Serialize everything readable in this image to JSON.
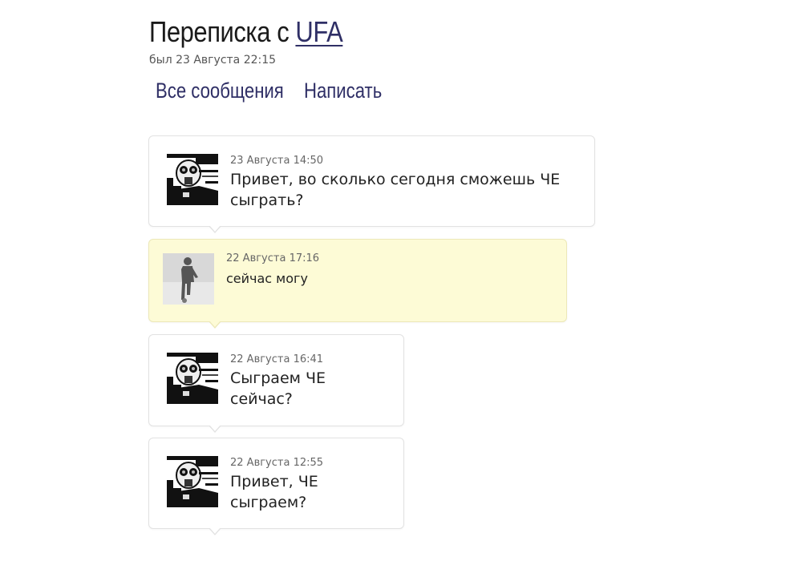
{
  "header": {
    "title_prefix": "Переписка с",
    "contact_name": "UFA",
    "last_seen": "был 23 Августа 22:15"
  },
  "tabs": [
    {
      "label": "Все сообщения"
    },
    {
      "label": "Написать"
    }
  ],
  "messages": [
    {
      "author": "UFA",
      "avatar_icon": "gas-mask-avatar-icon",
      "date": "23 Августа 14:50",
      "text_line1": "Привет, во сколько сегодня сможешь ЧЕ",
      "text_line2": "сыграть?",
      "mine": false
    },
    {
      "author": "me",
      "avatar_icon": "player-silhouette-avatar-icon",
      "date": "22 Августа 17:16",
      "text_line1": "сейчас могу",
      "text_line2": "",
      "mine": true
    },
    {
      "author": "UFA",
      "avatar_icon": "gas-mask-avatar-icon",
      "date": "22 Августа 16:41",
      "text_line1": "Сыграем ЧЕ",
      "text_line2": "сейчас?",
      "mine": false
    },
    {
      "author": "UFA",
      "avatar_icon": "gas-mask-avatar-icon",
      "date": "22 Августа 12:55",
      "text_line1": "Привет, ЧЕ",
      "text_line2": "сыграем?",
      "mine": false
    }
  ],
  "colors": {
    "link": "#2f2f66",
    "own_message_bg": "#fdfbd6",
    "message_border": "#e2e2e2"
  }
}
